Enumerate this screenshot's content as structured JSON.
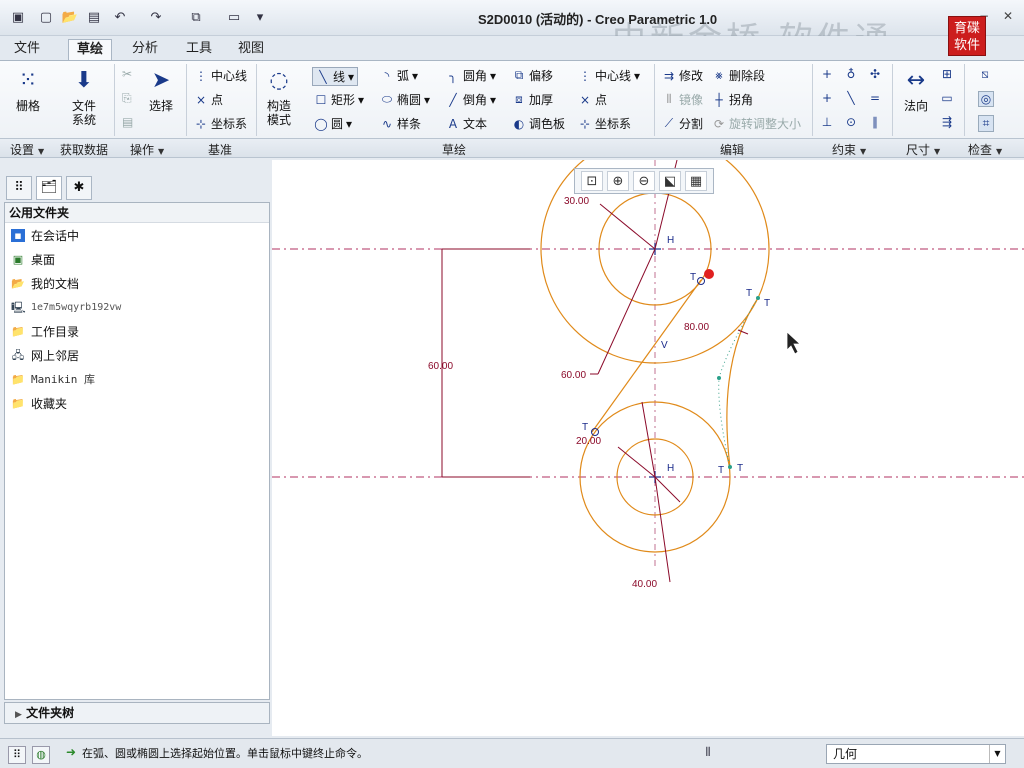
{
  "app": {
    "title": "S2D0010 (活动的) - Creo Parametric 1.0",
    "watermark": "中新金桥 软件通",
    "watermark_logo": "育碟\n软件"
  },
  "menu": {
    "tabs": [
      "文件",
      "草绘",
      "分析",
      "工具",
      "视图"
    ],
    "active_tab": "草绘"
  },
  "ribbon": {
    "settings": {
      "grid": "栅格"
    },
    "getdata": {
      "filesystem_line1": "文件",
      "filesystem_line2": "系统"
    },
    "operations": {
      "select": "选择"
    },
    "datum": {
      "centerline": "中心线",
      "point": "点",
      "coordsys": "坐标系"
    },
    "construct": {
      "line1": "构造",
      "line2": "模式"
    },
    "sketch": {
      "line": "线",
      "rect": "矩形",
      "circle": "圆",
      "arc": "弧",
      "ellipse": "椭圆",
      "spline": "样条",
      "fillet": "圆角",
      "chamfer": "倒角",
      "text": "文本",
      "offset": "偏移",
      "thicken": "加厚",
      "palette": "调色板",
      "centerline": "中心线",
      "point": "点",
      "coordsys": "坐标系"
    },
    "edit": {
      "modify": "修改",
      "delete_segment": "删除段",
      "mirror": "镜像",
      "corner": "拐角",
      "divide": "分割",
      "rotate_resize": "旋转调整大小"
    },
    "dimension": {
      "normal": "法向"
    },
    "groups": [
      "设置",
      "获取数据",
      "操作",
      "基准",
      "草绘",
      "编辑",
      "约束",
      "尺寸",
      "检查"
    ]
  },
  "left_panel": {
    "header": "公用文件夹",
    "items": [
      "在会话中",
      "桌面",
      "我的文档",
      "1e7m5wqyrb192vw",
      "工作目录",
      "网上邻居",
      "Manikin 库",
      "收藏夹"
    ],
    "folder_tree": "文件夹树"
  },
  "sketch": {
    "dimensions": [
      "30.00",
      "60.00",
      "80.00",
      "60.00",
      "20.00",
      "40.00"
    ],
    "constraint_labels": [
      "H",
      "V",
      "T"
    ]
  },
  "status": {
    "message": "在弧、圆或椭圆上选择起始位置。单击鼠标中键终止命令。",
    "filter": "几何"
  },
  "colors": {
    "sketch_orange": "#e08a1a",
    "dimension": "#8b0a2a",
    "centerline": "#b03060"
  }
}
